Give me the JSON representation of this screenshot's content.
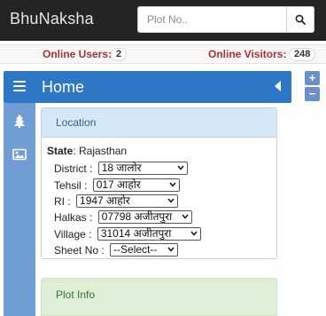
{
  "app": {
    "brand": "BhuNaksha",
    "search": {
      "placeholder": "Plot No..",
      "value": ""
    }
  },
  "stats": {
    "online_users_label": "Online Users:",
    "online_users_count": "2",
    "online_visitors_label": "Online Visitors:",
    "online_visitors_count": "248"
  },
  "panel_header": {
    "title": "Home"
  },
  "zoom": {
    "in": "+",
    "out": "−"
  },
  "sidebar": {
    "icons": [
      "tree-icon",
      "image-icon"
    ]
  },
  "location": {
    "title": "Location",
    "state_label": "State",
    "state_value": "Rajasthan",
    "fields": [
      {
        "label": "District :",
        "value": "18 जालोर"
      },
      {
        "label": "Tehsil :",
        "value": "017 आहोर"
      },
      {
        "label": "RI :",
        "value": "1947 आहोर"
      },
      {
        "label": "Halkas :",
        "value": "07798 अजीतपुरा"
      },
      {
        "label": "Village :",
        "value": "31014 अजीतपुरा"
      },
      {
        "label": "Sheet No :",
        "value": "--Select--"
      }
    ]
  },
  "plot_info": {
    "title": "Plot Info"
  },
  "colors": {
    "header_bg": "#242424",
    "home_bar": "#2d77c6",
    "side_rail": "#6f9dd4",
    "location_head": "#d6e8f7",
    "plot_info_bg": "#dfefd7",
    "stat_label": "#b03030"
  }
}
